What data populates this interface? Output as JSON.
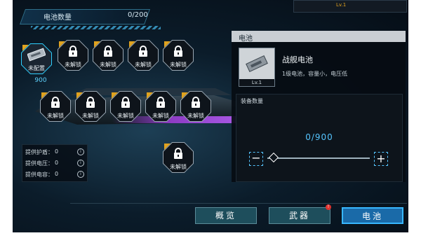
{
  "header": {
    "label": "电池数量",
    "count": "0/200"
  },
  "slots": {
    "first": {
      "label": "未配置",
      "count": "900"
    },
    "locked_label": "未解锁"
  },
  "stats": {
    "rows": [
      {
        "label": "提供护盾：",
        "value": "0"
      },
      {
        "label": "提供电压：",
        "value": "0"
      },
      {
        "label": "提供电容：",
        "value": "0"
      }
    ]
  },
  "top_hint": {
    "level": "Lv.1"
  },
  "panel": {
    "title": "电池",
    "item_name": "战舰电池",
    "item_desc": "1级电池，容量小，电压低",
    "item_level": "Lv.1",
    "equip_title": "装备数量",
    "equip_count": "0/900",
    "minus": "−",
    "plus": "+",
    "slider_fraction": 0.0
  },
  "nav": {
    "overview": "概览",
    "weapons": "武器",
    "battery": "电池",
    "weapons_badge": "!"
  },
  "colors": {
    "accent": "#38b7ff",
    "tag": "#e0a21e",
    "badge": "#e0322e"
  }
}
